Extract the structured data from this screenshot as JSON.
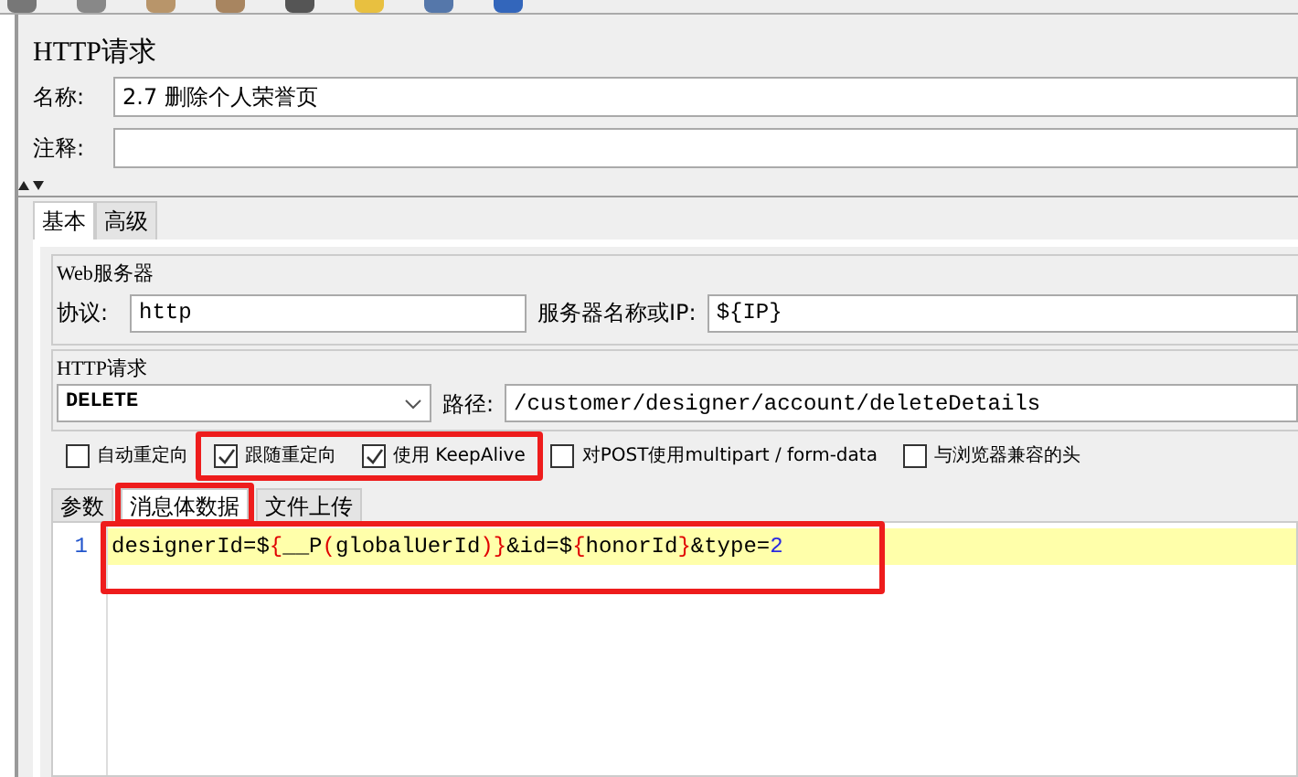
{
  "title": "HTTP请求",
  "name_field": {
    "label": "名称:",
    "value": "2.7 删除个人荣誉页"
  },
  "comment_field": {
    "label": "注释:"
  },
  "tabs": [
    {
      "label": "基本",
      "selected": true
    },
    {
      "label": "高级",
      "selected": false
    }
  ],
  "web_server": {
    "legend": "Web服务器",
    "protocol_label": "协议:",
    "protocol": "http",
    "server_label": "服务器名称或IP:",
    "server": "${IP}"
  },
  "http_request": {
    "legend": "HTTP请求",
    "method": "DELETE",
    "path_label": "路径:",
    "path": "/customer/designer/account/deleteDetails"
  },
  "options": [
    {
      "label": "自动重定向",
      "checked": false
    },
    {
      "label": "跟随重定向",
      "checked": true
    },
    {
      "label": "使用 KeepAlive",
      "checked": true
    },
    {
      "label": "对POST使用multipart / form-data",
      "checked": false
    },
    {
      "label": "与浏览器兼容的头",
      "checked": false
    }
  ],
  "sub_tabs": [
    {
      "label": "参数",
      "selected": false
    },
    {
      "label": "消息体数据",
      "selected": true
    },
    {
      "label": "文件上传",
      "selected": false
    }
  ],
  "editor": {
    "lines": [
      {
        "number": "1",
        "tokens": [
          {
            "kind": "text",
            "text": "designerId=$"
          },
          {
            "kind": "brace",
            "text": "{"
          },
          {
            "kind": "text",
            "text": "__P"
          },
          {
            "kind": "brace",
            "text": "("
          },
          {
            "kind": "text",
            "text": "globalUerId"
          },
          {
            "kind": "brace",
            "text": ")}"
          },
          {
            "kind": "text",
            "text": "&id=$"
          },
          {
            "kind": "brace",
            "text": "{"
          },
          {
            "kind": "text",
            "text": "honorId"
          },
          {
            "kind": "brace",
            "text": "}"
          },
          {
            "kind": "text",
            "text": "&type="
          },
          {
            "kind": "number",
            "text": "2"
          }
        ]
      }
    ]
  }
}
